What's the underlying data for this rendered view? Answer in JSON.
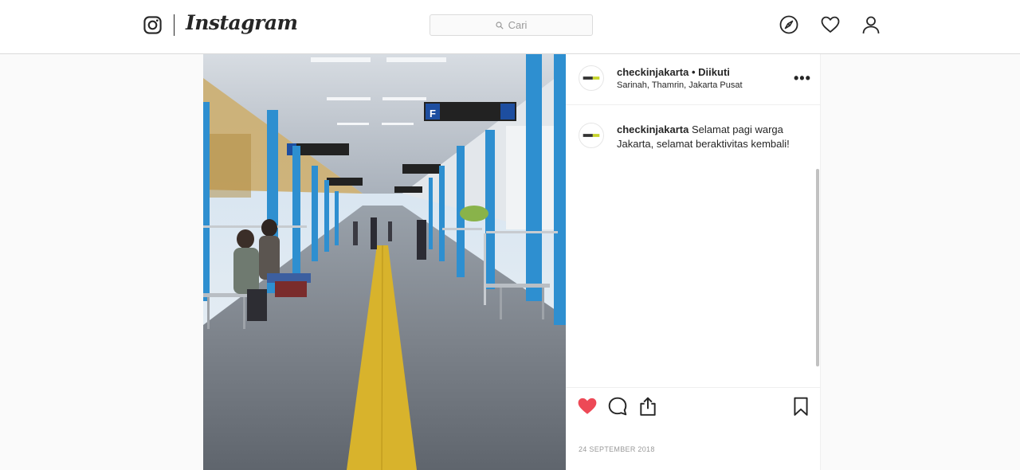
{
  "header": {
    "brand": "Instagram",
    "search_placeholder": "Cari",
    "icons": [
      "instagram-camera-icon",
      "search-icon",
      "compass-icon",
      "heart-icon",
      "profile-icon"
    ]
  },
  "post": {
    "username": "checkinjakarta",
    "follow_status": "Diikuti",
    "separator": "•",
    "location": "Sarinah, Thamrin, Jakarta Pusat",
    "more_label": "•••",
    "caption": {
      "username": "checkinjakarta",
      "text": "Selamat pagi warga Jakarta, selamat beraktivitas kembali!"
    },
    "liked": true,
    "like_color": "#ed4956",
    "date": "24 SEPTEMBER 2018",
    "action_icons": [
      "heart-filled-icon",
      "comment-icon",
      "share-icon",
      "bookmark-icon"
    ],
    "photo_sign": "F"
  }
}
